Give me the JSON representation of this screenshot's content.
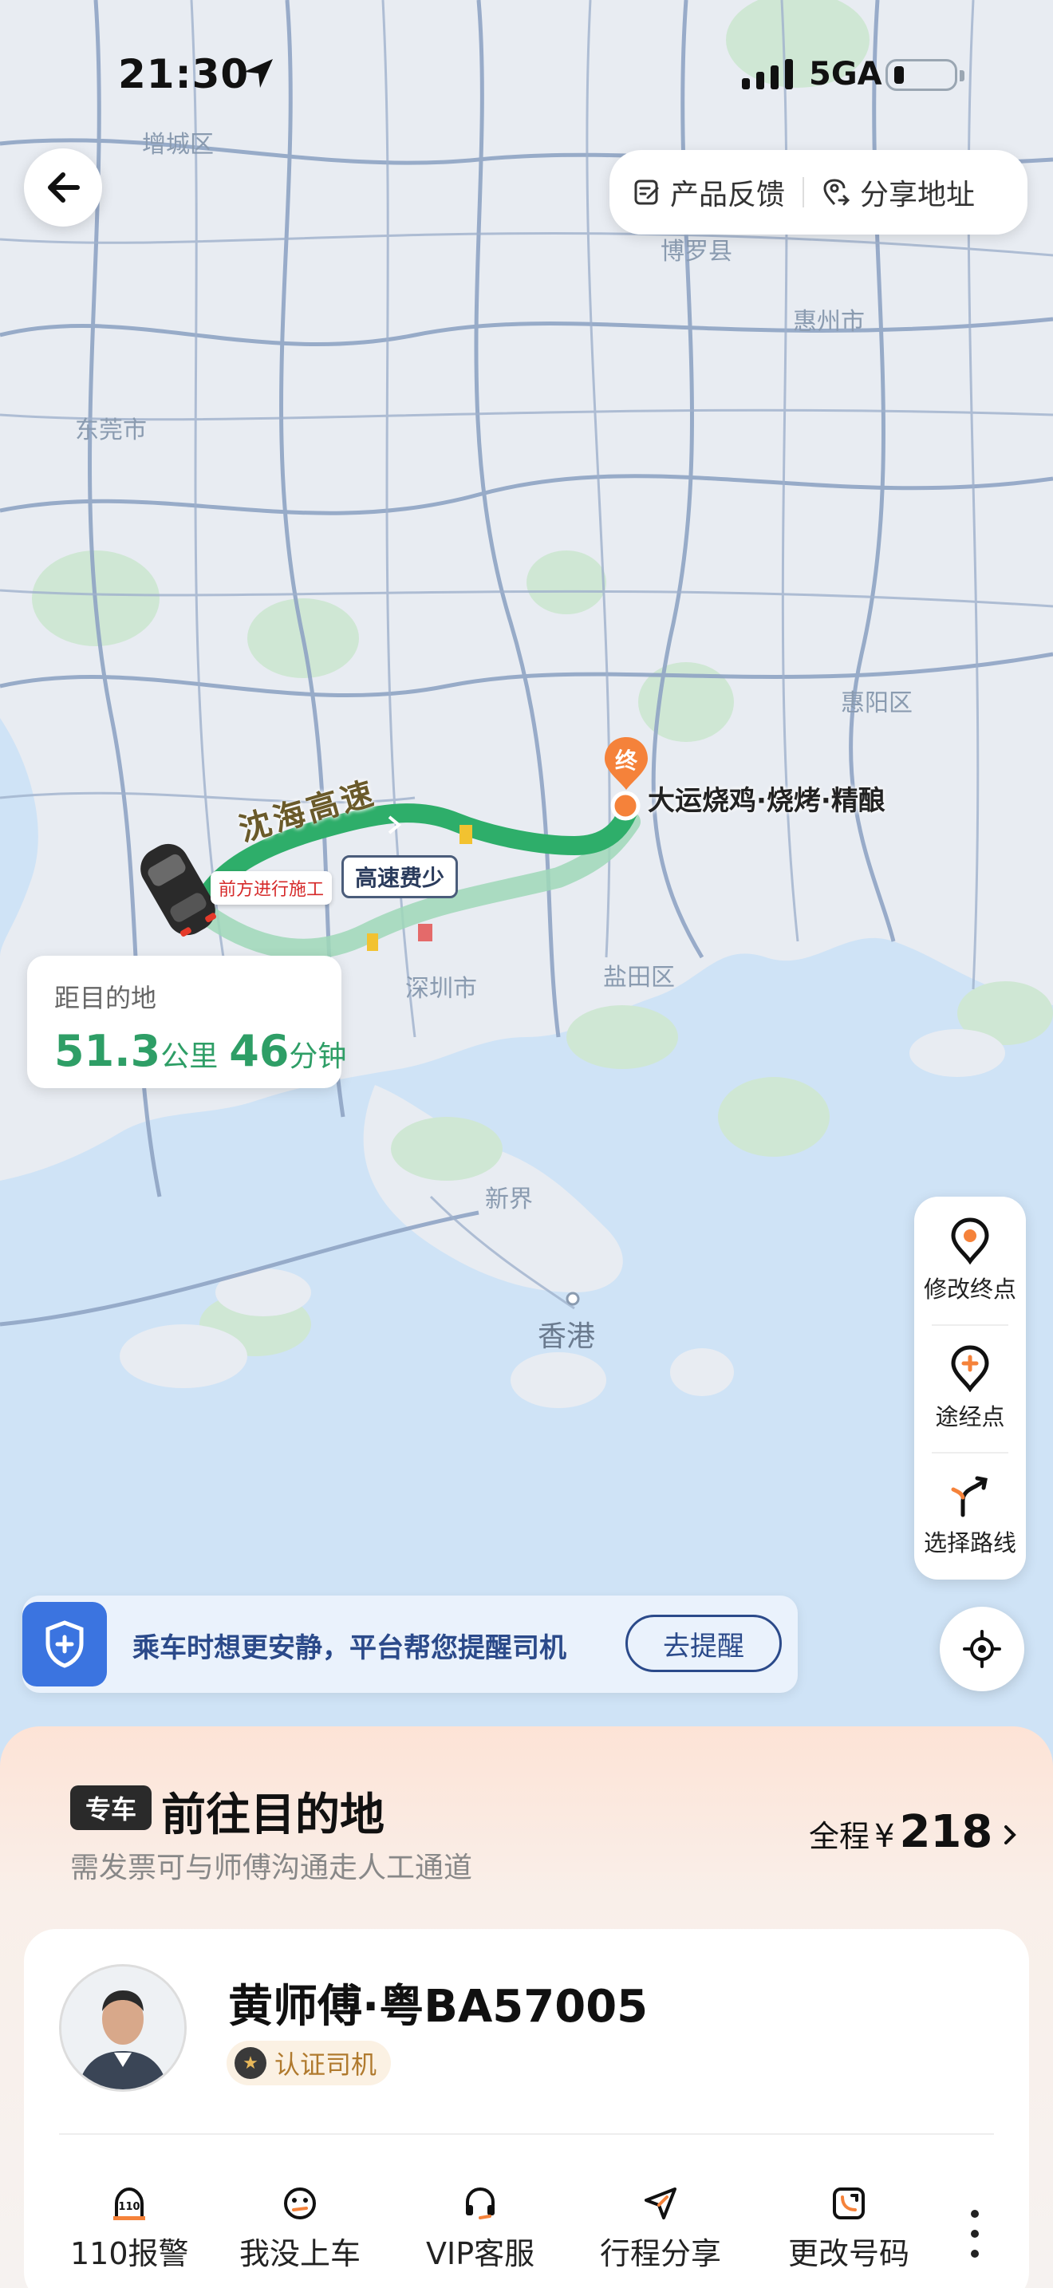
{
  "status": {
    "time": "21:30",
    "network": "5GA"
  },
  "top_bar": {
    "feedback_label": "产品反馈",
    "share_label": "分享地址"
  },
  "map": {
    "place_labels": [
      "增城区",
      "博罗县",
      "惠州市",
      "东莞市",
      "惠阳区",
      "深圳市",
      "盐田区",
      "新界",
      "香港"
    ],
    "end_marker": "终",
    "destination_name": "大运烧鸡·烧烤·精酿",
    "road_name": "沈海高速",
    "highway_tag": "高速费少",
    "construction_tag": "前方进行施工"
  },
  "distance_card": {
    "label": "距目的地",
    "distance_value": "51.3",
    "distance_unit": "公里",
    "time_value": "46",
    "time_unit": "分钟"
  },
  "tools": [
    {
      "label": "修改终点",
      "icon": "pin-icon"
    },
    {
      "label": "途经点",
      "icon": "add-pin-icon"
    },
    {
      "label": "选择路线",
      "icon": "route-fork-icon"
    }
  ],
  "safety": {
    "message": "乘车时想更安静，平台帮您提醒司机",
    "button_label": "去提醒"
  },
  "trip": {
    "tag": "专车",
    "title": "前往目的地",
    "subtitle": "需发票可与师傅沟通走人工通道",
    "fare_prefix": "全程",
    "fare_currency": "¥",
    "fare_amount": "218"
  },
  "driver": {
    "name": "黄师傅·粤BA57005",
    "cert_label": "认证司机"
  },
  "actions": [
    {
      "label": "110报警",
      "icon": "police-110-icon"
    },
    {
      "label": "我没上车",
      "icon": "not-boarded-icon"
    },
    {
      "label": "VIP客服",
      "icon": "headset-icon"
    },
    {
      "label": "行程分享",
      "icon": "share-plane-icon"
    },
    {
      "label": "更改号码",
      "icon": "change-phone-icon"
    }
  ],
  "colors": {
    "route_green": "#2eae6a",
    "accent_orange": "#f5823a",
    "brand_blue": "#3b74e0",
    "price_green": "#2e9e66"
  }
}
